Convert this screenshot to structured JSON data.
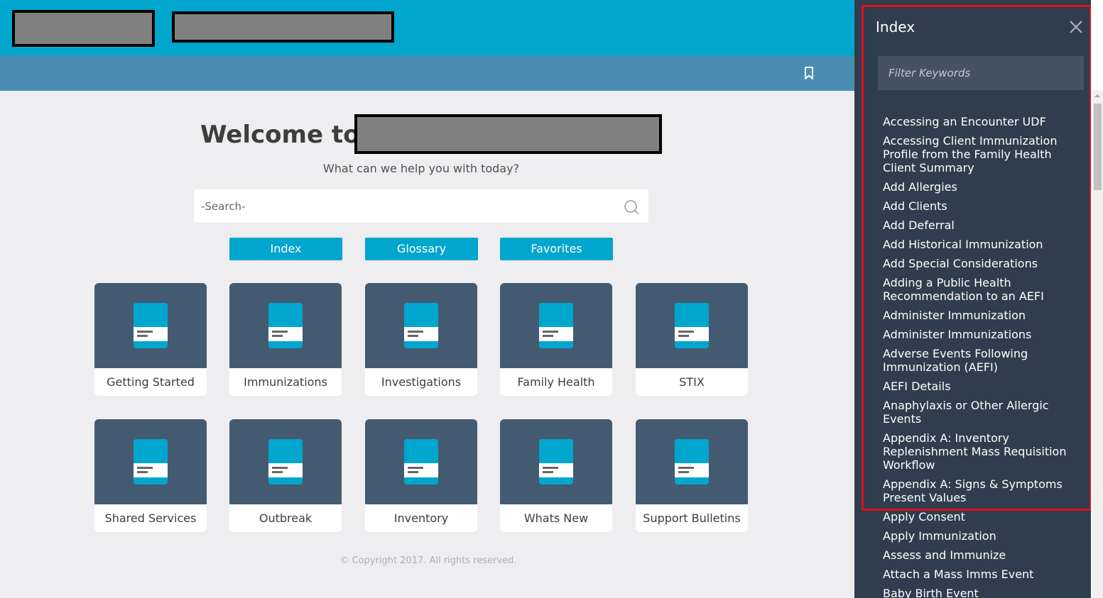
{
  "header": {
    "bookmark_icon": "bookmark-icon"
  },
  "main": {
    "welcome_prefix": "Welcome to",
    "tagline": "What can we help you with today?",
    "search_placeholder": "-Search-",
    "search_icon": "search-icon",
    "nav_buttons": [
      "Index",
      "Glossary",
      "Favorites"
    ],
    "tiles": [
      "Getting Started",
      "Immunizations",
      "Investigations",
      "Family Health",
      "STIX",
      "Shared Services",
      "Outbreak",
      "Inventory",
      "Whats New",
      "Support Bulletins"
    ],
    "tile_icon": "document-icon",
    "copyright": "© Copyright 2017. All rights reserved."
  },
  "panel": {
    "title": "Index",
    "close_icon": "close-icon",
    "filter_placeholder": "Filter Keywords",
    "items": [
      "Accessing an Encounter UDF",
      "Accessing Client Immunization Profile from the Family Health Client Summary",
      "Add Allergies",
      "Add Clients",
      "Add Deferral",
      "Add Historical Immunization",
      "Add Special Considerations",
      "Adding a Public Health Recommendation to an AEFI",
      "Administer Immunization",
      "Administer Immunizations",
      "Adverse Events Following Immunization (AEFI)",
      "AEFI Details",
      "Anaphylaxis or Other Allergic Events",
      "Appendix A: Inventory Replenishment Mass Requisition Workflow",
      "Appendix A: Signs & Symptoms Present Values",
      "Apply Consent",
      "Apply Immunization",
      "Assess and Immunize",
      "Attach a Mass Imms Event",
      "Baby Birth Event"
    ]
  },
  "colors": {
    "header": "#00a6ce",
    "subheader": "#4a8db3",
    "panel": "#2f3d4e",
    "tile_top": "#445a71",
    "accent": "#00a6ce",
    "highlight": "#e0101a"
  }
}
